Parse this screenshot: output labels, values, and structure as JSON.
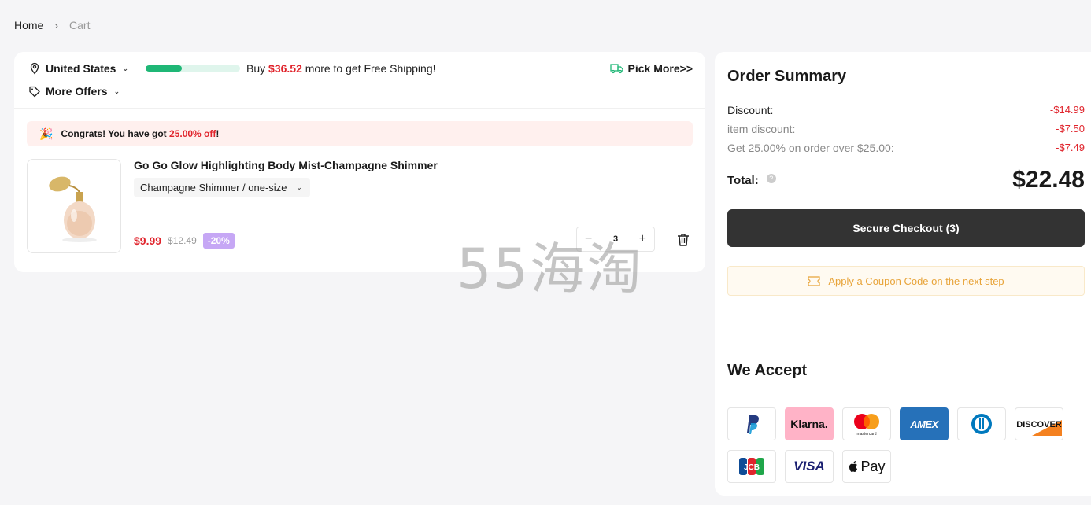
{
  "breadcrumb": {
    "home": "Home",
    "separator": "›",
    "current": "Cart"
  },
  "shipping": {
    "country": "United States",
    "progress_fraction": 0.38,
    "text_before": "Buy ",
    "amount": "$36.52",
    "text_after": " more to get Free Shipping!",
    "pick_more": "Pick More>>"
  },
  "offers": {
    "label": "More Offers"
  },
  "congrats": {
    "prefix": "Congrats! You have got ",
    "percent": "25.00% off",
    "suffix": "!"
  },
  "item": {
    "title": "Go Go Glow Highlighting Body Mist-Champagne Shimmer",
    "variant": "Champagne Shimmer / one-size",
    "price": "$9.99",
    "original_price": "$12.49",
    "discount": "-20%",
    "quantity": "3",
    "minus": "−",
    "plus": "+"
  },
  "watermark": "55海淘",
  "summary": {
    "title": "Order Summary",
    "lines": [
      {
        "label": "Discount:",
        "value": "-$14.99"
      },
      {
        "label": "item discount:",
        "value": "-$7.50"
      },
      {
        "label": "Get 25.00% on order over $25.00:",
        "value": "-$7.49"
      }
    ],
    "total_label": "Total:",
    "total_info": "?",
    "total_value": "$22.48",
    "checkout_label": "Secure Checkout (3)",
    "coupon_label": "Apply a Coupon Code on the next step"
  },
  "payments": {
    "title": "We Accept",
    "methods": [
      "PayPal",
      "Klarna.",
      "mastercard",
      "AMEX",
      "Diners Club",
      "DISCOVER",
      "JCB",
      "VISA",
      "Pay"
    ]
  },
  "colors": {
    "accent_red": "#e0242c",
    "progress_green": "#1fb776",
    "checkout_dark": "#333333",
    "coupon_orange": "#e8a43a",
    "discount_badge": "#c6a7f5"
  }
}
